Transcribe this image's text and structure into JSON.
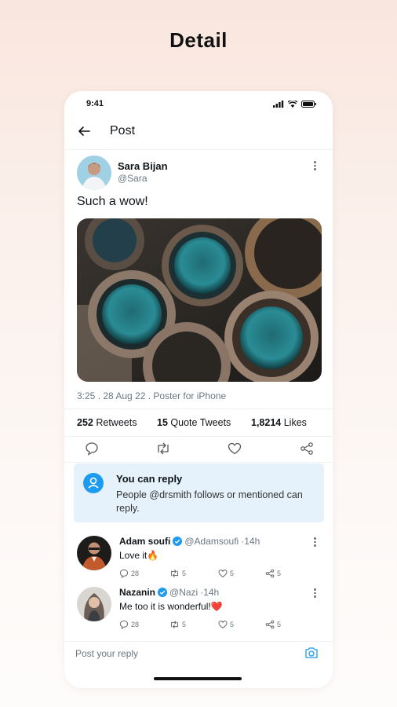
{
  "page_title": "Detail",
  "status_bar": {
    "time": "9:41"
  },
  "nav": {
    "title": "Post"
  },
  "post": {
    "author_name": "Sara Bijan",
    "author_handle": "@Sara",
    "text": "Such a wow!",
    "meta": "3:25 . 28 Aug 22 . Poster for iPhone",
    "stats": {
      "retweets_count": "252",
      "retweets_label": "Retweets",
      "quotes_count": "15",
      "quotes_label": "Quote Tweets",
      "likes_count": "1,8214",
      "likes_label": "Likes"
    }
  },
  "reply_info": {
    "title": "You can reply",
    "body": "People @drsmith follows or mentioned can reply."
  },
  "replies": [
    {
      "name": "Adam soufi",
      "handle": "@Adamsoufi",
      "time": "·14h",
      "text": "Love it🔥",
      "comments": "28",
      "retweets": "5",
      "likes": "5",
      "shares": "5"
    },
    {
      "name": "Nazanin",
      "handle": "@Nazi",
      "time": "·14h",
      "text": "Me too it is wonderful!❤️",
      "comments": "28",
      "retweets": "5",
      "likes": "5",
      "shares": "5"
    }
  ],
  "composer": {
    "placeholder": "Post your reply"
  },
  "colors": {
    "accent": "#1d9bf0",
    "reply_box_bg": "#e5f2fb",
    "verified": "#1d9bf0"
  }
}
